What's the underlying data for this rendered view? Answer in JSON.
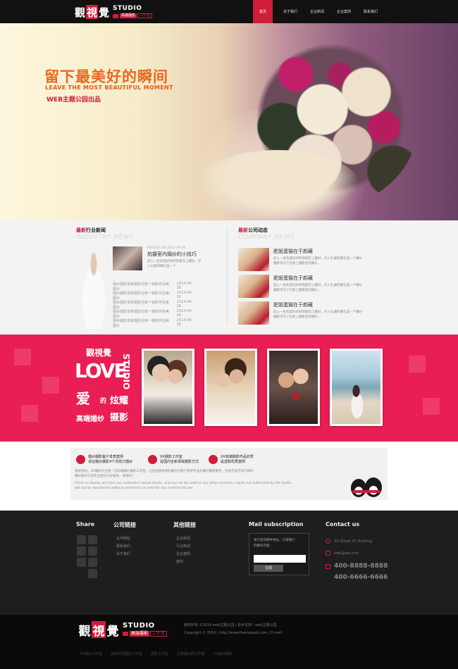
{
  "brand": {
    "chars": [
      "觀",
      "視",
      "覺"
    ],
    "studio": "STUDIO",
    "tag": "高端摄影",
    "tag2": "工作室"
  },
  "nav": {
    "items": [
      "首页",
      "关于我们",
      "企业新闻",
      "企业案例",
      "联系我们"
    ]
  },
  "banner": {
    "title": "留下最美好的瞬间",
    "subtitle": "LEAVE THE MOST BEAUTIFUL MOMENT",
    "credit": "WEB主题公园出品"
  },
  "industry": {
    "heading_em": "最新",
    "heading": "行业新闻",
    "heading_en": "INDUSTRY NEWS",
    "featured_date": "POSTED ON 2014-09-26",
    "featured_title": "拍摄室内婚纱的小技巧",
    "featured_text": [
      "您入一生的美好的时刻留在上最好，许",
      "入礼服的婚礼是一个..."
    ],
    "list": [
      {
        "title": "婚纱摄影安和婚影社新一辑新作完美展示",
        "date": "2014-09-26"
      },
      {
        "title": "婚纱摄影安和婚影社新一辑新作完美展示",
        "date": "2014-09-26"
      },
      {
        "title": "婚纱摄影安和婚影社新一辑新作完美展示",
        "date": "2014-09-26"
      },
      {
        "title": "婚纱摄影安和婚影社新一辑新作完美展示",
        "date": "2014-09-26"
      },
      {
        "title": "婚纱摄影安和婚影社新一辑新作完美展示",
        "date": "2014-09-26"
      }
    ]
  },
  "company": {
    "heading_em": "最新",
    "heading": "公司动态",
    "heading_en": "COMPANY NEWS",
    "items": [
      {
        "title": "肥姐蛋猫在于颜藏",
        "text": [
          "您入一生的美好的时刻留在上最好，许入礼服的婚礼是一个婚纱",
          "摄影作为了在影上摄影后的婚礼..."
        ]
      },
      {
        "title": "肥姐蛋猫在于颜藏",
        "text": [
          "您入一生的美好的时刻留在上最好，许入礼服的婚礼是一个婚纱",
          "摄影作为了在影上摄影后的婚礼..."
        ]
      },
      {
        "title": "肥姐蛋猫在于颜藏",
        "text": [
          "您入一生的美好的时刻留在上最好，许入礼服的婚礼是一个婚纱",
          "摄影作为了在影上摄影后的婚礼..."
        ]
      }
    ]
  },
  "love": {
    "logo_top": "觀視覺",
    "studio": "STUDIO",
    "love_word": "LOVE",
    "ai": "爱",
    "de": "的",
    "xuanyao": "炫耀",
    "line": "高端婚纱",
    "sheying": "摄影"
  },
  "info": {
    "items": [
      {
        "l1": "婚纱摄影客户发表案例",
        "l2": "请在婚纱摄影4个月前订婚纱"
      },
      {
        "l1": "XX摄影工作室",
        "l2": "是国内全新领域摄影方式"
      },
      {
        "l1": "XX高端摄影作品欣赏",
        "l2": "是选取优秀案例"
      }
    ],
    "desc1": [
      "观视觉坊，XX摄影为全国一流高端婚纱摄影工作室，立足品牌优秀的服务为客户提供专业的婚纱摄影服务，为您打造不同凡响的",
      "婚纱照片打造专业团队为您服务。请预约！"
    ],
    "desc2": [
      "Prints on display are from our customers' actual shoots, and can not be used on any other occasion; copies not authorized by the studio",
      "will not be reproduced without permission or used for any commercial use."
    ]
  },
  "footer": {
    "share": "Share",
    "links_title": "公司链接",
    "links": [
      "合作网站",
      "联系我们",
      "关于我们"
    ],
    "other_title": "其他链接",
    "other": [
      "企业新闻",
      "行业新闻",
      "企业案例",
      "案例"
    ],
    "mail_title": "Mail subscription",
    "mail_text": [
      "填写您的邮件地址，订阅我们",
      "的精彩内容："
    ],
    "mail_button": "订阅",
    "contact_title": "Contact us",
    "address": "XX Street XX Building",
    "email": "web@gfx.com",
    "phone1": "400-8888-8888",
    "phone2": "400-6666-6666"
  },
  "bottom": {
    "line1": "版权所有 ©2014 web主题公园 | 技术支持：web主题公园",
    "line2": "Copyright © 2014 | http://www.themepark.com | E-mail",
    "links": [
      "XX婚纱工作室",
      "海滨风情摄影工作室",
      "摄影工作室",
      "古典婚纱照工作室",
      "XX婚纱摄影"
    ]
  },
  "colors": {
    "accent": "#d01d3a",
    "love_bg": "#e91e54",
    "footer_bg": "#1e1e1e",
    "bottom_bg": "#0a0a0a"
  }
}
